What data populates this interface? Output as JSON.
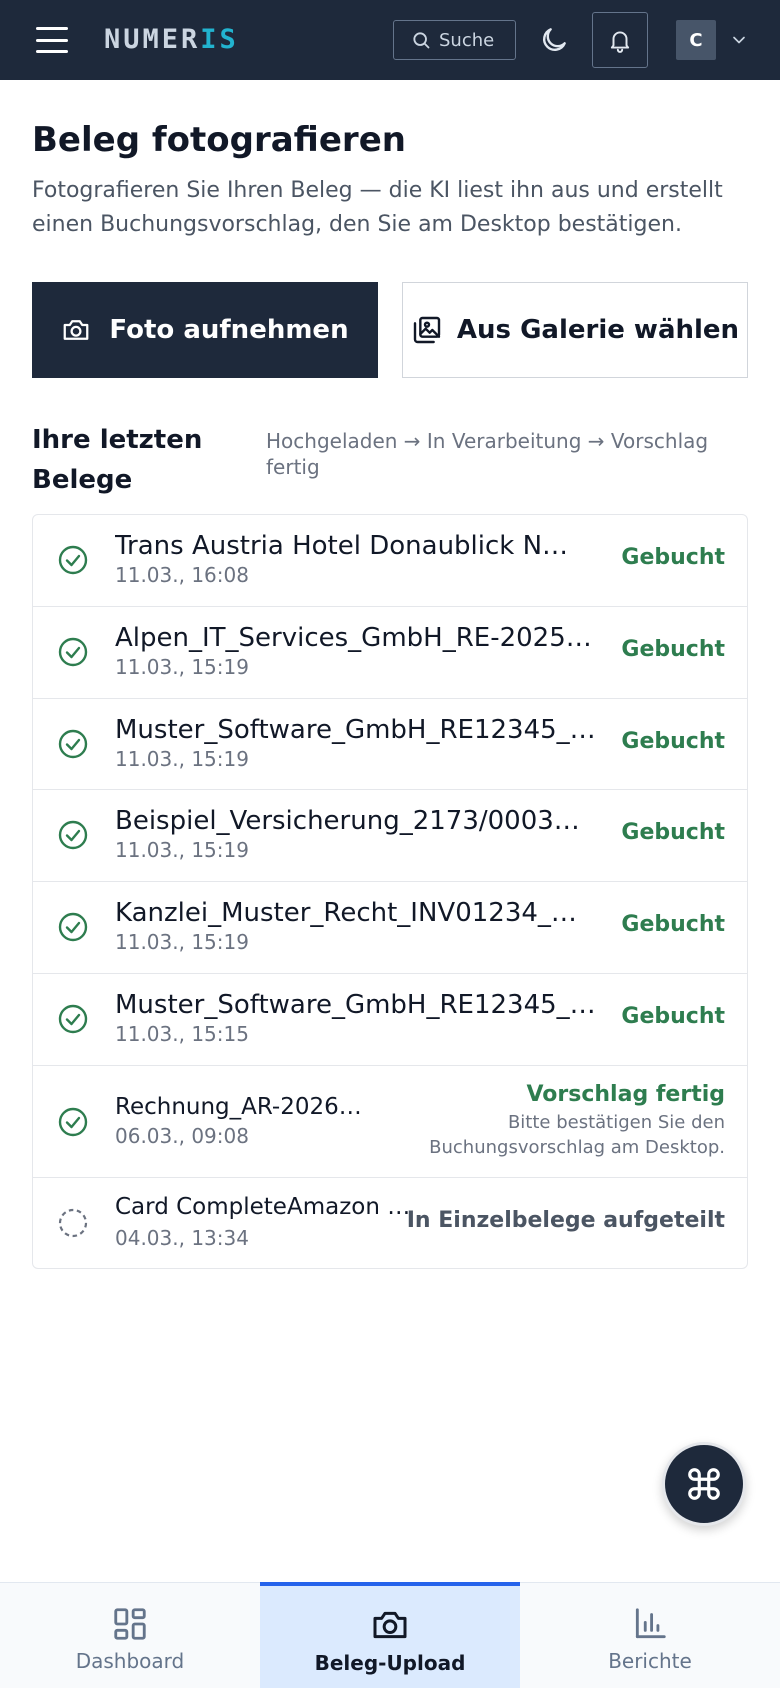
{
  "header": {
    "logo_main": "NUMER",
    "logo_accent": "IS",
    "search_label": "Suche",
    "avatar_initial": "C",
    "accent_color": "#22b3cf"
  },
  "page": {
    "title": "Beleg fotografieren",
    "description": "Fotografieren Sie Ihren Beleg — die KI liest ihn aus und erstellt einen Buchungsvorschlag, den Sie am Desktop bestätigen."
  },
  "actions": {
    "take_photo": "Foto aufnehmen",
    "choose_gallery": "Aus Galerie wählen"
  },
  "recent": {
    "title": "Ihre letzten Belege",
    "flow_hint": "Hochgeladen → In Verarbeitung → Vorschlag fertig",
    "items": [
      {
        "name": "Trans Austria Hotel Donaublick N…",
        "time": "11.03., 16:08",
        "status": "Gebucht",
        "icon": "check-circle-icon"
      },
      {
        "name": "Alpen_IT_Services_GmbH_RE-2025…",
        "time": "11.03., 15:19",
        "status": "Gebucht",
        "icon": "check-circle-icon"
      },
      {
        "name": "Muster_Software_GmbH_RE12345_…",
        "time": "11.03., 15:19",
        "status": "Gebucht",
        "icon": "check-circle-icon"
      },
      {
        "name": "Beispiel_Versicherung_2173/0003…",
        "time": "11.03., 15:19",
        "status": "Gebucht",
        "icon": "check-circle-icon"
      },
      {
        "name": "Kanzlei_Muster_Recht_INV01234_…",
        "time": "11.03., 15:19",
        "status": "Gebucht",
        "icon": "check-circle-icon"
      },
      {
        "name": "Muster_Software_GmbH_RE12345_…",
        "time": "11.03., 15:15",
        "status": "Gebucht",
        "icon": "check-circle-icon"
      },
      {
        "name": "Rechnung_AR-2026…",
        "time": "06.03., 09:08",
        "status": "Vorschlag fertig",
        "hint": "Bitte bestätigen Sie den Buchungsvorschlag am Desktop.",
        "icon": "check-circle-icon"
      },
      {
        "name": "Card CompleteAmazon …",
        "time": "04.03., 13:34",
        "status": "In Einzelbelege aufgeteilt",
        "icon": "dashed-circle-icon"
      }
    ]
  },
  "fab": {
    "icon": "command-icon"
  },
  "bottom_nav": {
    "items": [
      {
        "label": "Dashboard",
        "icon": "dashboard-icon",
        "active": false
      },
      {
        "label": "Beleg-Upload",
        "icon": "camera-icon",
        "active": true
      },
      {
        "label": "Berichte",
        "icon": "bar-chart-icon",
        "active": false
      }
    ]
  },
  "colors": {
    "header_bg": "#1e293b",
    "success": "#2e7d4f",
    "nav_active_bg": "#dbeafe",
    "nav_active_border": "#2563eb"
  }
}
